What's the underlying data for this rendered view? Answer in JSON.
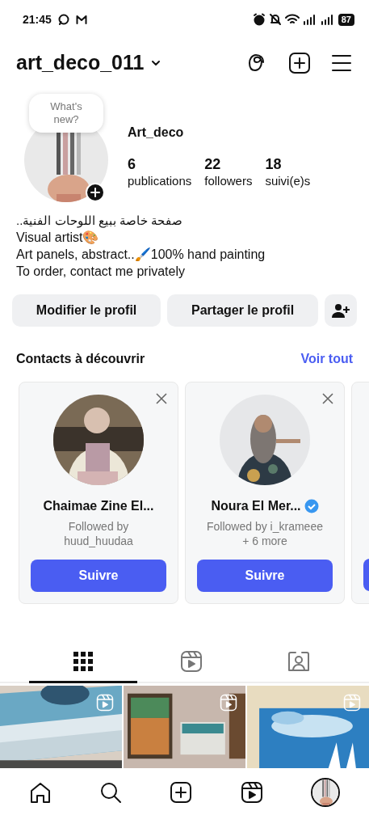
{
  "status_bar": {
    "time": "21:45",
    "battery": "87"
  },
  "header": {
    "username": "art_deco_011"
  },
  "profile": {
    "note": "What's new?",
    "name": "Art_deco",
    "stats": [
      {
        "value": "6",
        "label": "publications"
      },
      {
        "value": "22",
        "label": "followers"
      },
      {
        "value": "18",
        "label": "suivi(e)s"
      }
    ],
    "bio": [
      "صفحة خاصة ببيع اللوحات الفنية..",
      "Visual artist🎨",
      "Art panels, abstract..🖌️100% hand painting",
      "To order, contact me privately"
    ]
  },
  "actions": [
    "Modifier le profil",
    "Partager le profil"
  ],
  "suggestions": {
    "title": "Contacts à découvrir",
    "see_all": "Voir tout",
    "cards": [
      {
        "name": "Chaimae Zine El...",
        "verified": false,
        "followed_by": [
          "Followed by",
          "huud_huudaa"
        ],
        "button": "Suivre"
      },
      {
        "name": "Noura El Mer...",
        "verified": true,
        "followed_by": [
          "Followed by i_krameee",
          "+ 6 more"
        ],
        "button": "Suivre"
      }
    ]
  },
  "content_tabs": [
    {
      "kind": "grid",
      "selected": true
    },
    {
      "kind": "reels",
      "selected": false
    },
    {
      "kind": "tagged",
      "selected": false
    }
  ],
  "posts": [
    {
      "kind": "picture",
      "reel": true
    },
    {
      "kind": "picture",
      "reel": true
    },
    {
      "kind": "picture",
      "reel": true
    }
  ],
  "bottom_nav": [
    {
      "kind": "home"
    },
    {
      "kind": "search"
    },
    {
      "kind": "create"
    },
    {
      "kind": "reels"
    },
    {
      "kind": "profile"
    }
  ]
}
